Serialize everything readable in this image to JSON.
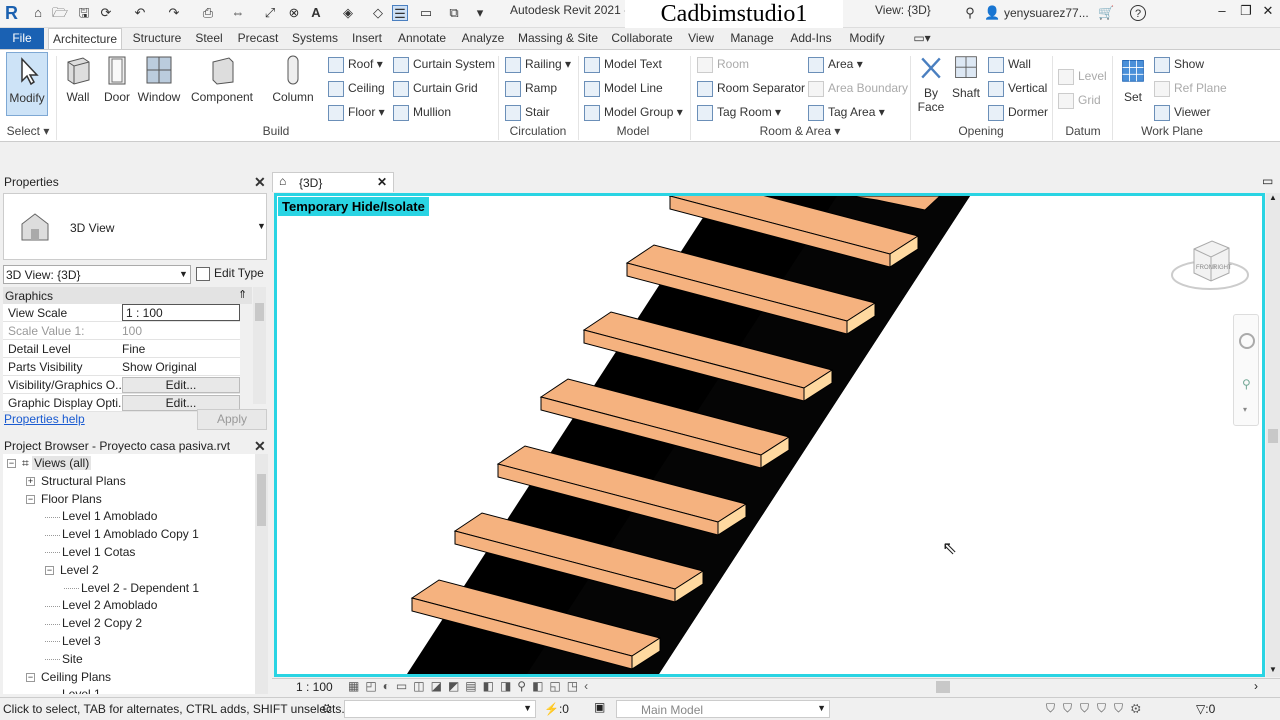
{
  "title_bar": {
    "app_title": "Autodesk Revit 2021 -",
    "watermark": "Cadbimstudio1",
    "view_title": "View: {3D}",
    "user": "yenysuarez77..."
  },
  "tabs": [
    "File",
    "Architecture",
    "Structure",
    "Steel",
    "Precast",
    "Systems",
    "Insert",
    "Annotate",
    "Analyze",
    "Massing & Site",
    "Collaborate",
    "View",
    "Manage",
    "Add-Ins",
    "Modify"
  ],
  "ribbon": {
    "select_label": "Select",
    "modify": "Modify",
    "build": {
      "label": "Build",
      "wall": "Wall",
      "door": "Door",
      "window": "Window",
      "component": "Component",
      "column": "Column",
      "roof": "Roof",
      "ceiling": "Ceiling",
      "floor": "Floor",
      "curtain_system": "Curtain System",
      "curtain_grid": "Curtain Grid",
      "mullion": "Mullion"
    },
    "circulation": {
      "label": "Circulation",
      "railing": "Railing",
      "ramp": "Ramp",
      "stair": "Stair"
    },
    "model": {
      "label": "Model",
      "model_text": "Model Text",
      "model_line": "Model Line",
      "model_group": "Model Group"
    },
    "room_area": {
      "label": "Room & Area",
      "room": "Room",
      "room_separator": "Room Separator",
      "tag_room": "Tag Room",
      "area": "Area",
      "area_boundary": "Area Boundary",
      "tag_area": "Tag Area"
    },
    "opening": {
      "label": "Opening",
      "by_face": "By Face",
      "shaft": "Shaft",
      "wall": "Wall",
      "vertical": "Vertical",
      "dormer": "Dormer"
    },
    "datum": {
      "label": "Datum",
      "level": "Level",
      "grid": "Grid"
    },
    "work_plane": {
      "label": "Work Plane",
      "set": "Set",
      "show": "Show",
      "ref_plane": "Ref Plane",
      "viewer": "Viewer"
    }
  },
  "properties": {
    "title": "Properties",
    "type_name": "3D View",
    "instance_selector": "3D View: {3D}",
    "edit_type": "Edit Type",
    "group": "Graphics",
    "rows": [
      {
        "k": "View Scale",
        "v": "1 : 100"
      },
      {
        "k": "Scale Value    1:",
        "v": "100"
      },
      {
        "k": "Detail Level",
        "v": "Fine"
      },
      {
        "k": "Parts Visibility",
        "v": "Show Original"
      },
      {
        "k": "Visibility/Graphics O...",
        "v": "Edit..."
      },
      {
        "k": "Graphic Display Opti...",
        "v": "Edit..."
      }
    ],
    "help": "Properties help",
    "apply": "Apply"
  },
  "browser": {
    "title": "Project Browser - Proyecto casa pasiva.rvt",
    "items": [
      {
        "label": "Views (all)",
        "level": 0,
        "tg": "−"
      },
      {
        "label": "Structural Plans",
        "level": 1,
        "tg": "+"
      },
      {
        "label": "Floor Plans",
        "level": 1,
        "tg": "−"
      },
      {
        "label": "Level 1 Amoblado",
        "level": 2,
        "tg": ""
      },
      {
        "label": "Level 1 Amoblado Copy 1",
        "level": 2,
        "tg": ""
      },
      {
        "label": "Level 1 Cotas",
        "level": 2,
        "tg": ""
      },
      {
        "label": "Level 2",
        "level": 2,
        "tg": "−"
      },
      {
        "label": "Level 2 - Dependent 1",
        "level": 3,
        "tg": ""
      },
      {
        "label": "Level 2 Amoblado",
        "level": 2,
        "tg": ""
      },
      {
        "label": "Level 2 Copy 2",
        "level": 2,
        "tg": ""
      },
      {
        "label": "Level 3",
        "level": 2,
        "tg": ""
      },
      {
        "label": "Site",
        "level": 2,
        "tg": ""
      },
      {
        "label": "Ceiling Plans",
        "level": 1,
        "tg": "−"
      },
      {
        "label": "Level 1",
        "level": 2,
        "tg": ""
      }
    ]
  },
  "view": {
    "tab_label": "{3D}",
    "temp_label": "Temporary Hide/Isolate",
    "scale": "1 : 100",
    "viewcube_front": "FRONT",
    "viewcube_right": "RIGHT"
  },
  "status": {
    "hint": "Click to select, TAB for alternates, CTRL adds, SHIFT unselects.",
    "filter_count": ":0",
    "model": "Main Model",
    "select_count": ":0"
  },
  "colors": {
    "file_tab": "#1a61b3",
    "hide_isolate": "#29d4e3",
    "tread": "#f5b27f",
    "tread_edge": "#ffd9a0",
    "stringer": "#000000"
  }
}
